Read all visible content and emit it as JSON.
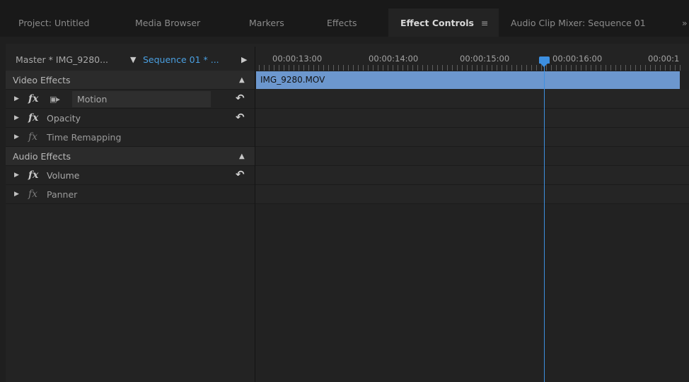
{
  "tabs": [
    {
      "label": "Project: Untitled",
      "active": false
    },
    {
      "label": "Media Browser",
      "active": false
    },
    {
      "label": "Markers",
      "active": false
    },
    {
      "label": "Effects",
      "active": false
    },
    {
      "label": "Effect Controls",
      "active": true
    },
    {
      "label": "Audio Clip Mixer: Sequence 01",
      "active": false
    }
  ],
  "tab_menu_icon": "≡",
  "tab_overflow": "»",
  "source": {
    "master_label": "Master * IMG_9280...",
    "sequence_label": "Sequence 01 * ...",
    "dropdown_icon": "▼",
    "show_timeline_icon": "▶"
  },
  "video_effects": {
    "label": "Video Effects",
    "collapse_icon": "▲",
    "items": [
      {
        "name": "Motion",
        "fx": "fx",
        "enabled": true,
        "reset": "↶"
      },
      {
        "name": "Opacity",
        "fx": "fx",
        "enabled": true,
        "reset": "↶"
      },
      {
        "name": "Time Remapping",
        "fx": "fx",
        "enabled": false
      }
    ]
  },
  "audio_effects": {
    "label": "Audio Effects",
    "collapse_icon": "▲",
    "items": [
      {
        "name": "Volume",
        "fx": "fx",
        "enabled": true,
        "reset": "↶"
      },
      {
        "name": "Panner",
        "fx": "fx",
        "enabled": false
      }
    ]
  },
  "expand_icon": "▶",
  "motion_toggle_icon": "▣▸",
  "timeline": {
    "ticks": [
      "00:00:13:00",
      "00:00:14:00",
      "00:00:15:00",
      "00:00:16:00",
      "00:00:1"
    ],
    "clip_name": "IMG_9280.MOV",
    "playhead_color": "#3d8fe0",
    "clip_color": "#6c97ce"
  }
}
